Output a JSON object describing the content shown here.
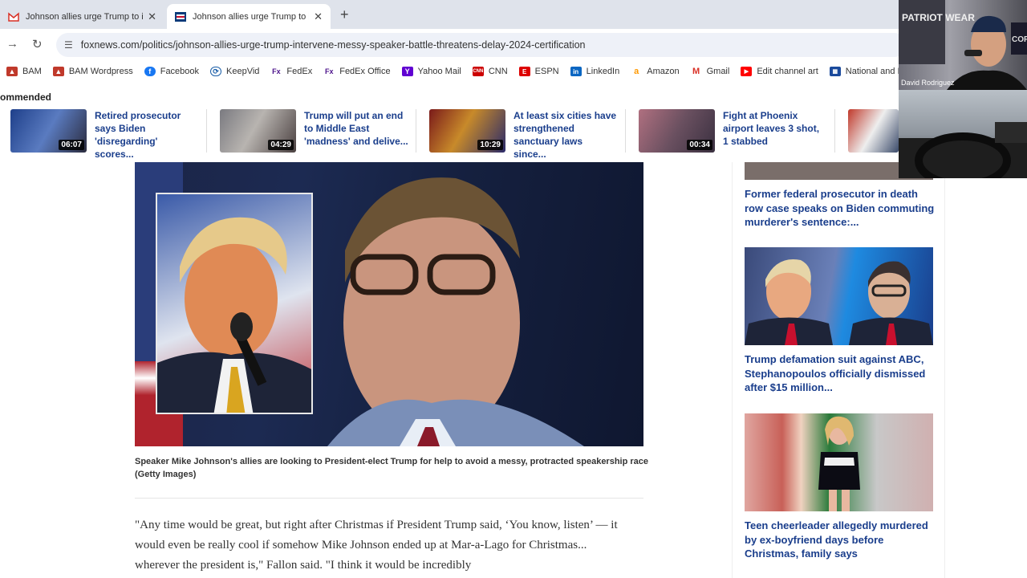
{
  "tabs": [
    {
      "title": "Johnson allies urge Trump to in",
      "active": false,
      "icon": "gmail-icon"
    },
    {
      "title": "Johnson allies urge Trump to in",
      "active": true,
      "icon": "foxnews-icon"
    }
  ],
  "url": "foxnews.com/politics/johnson-allies-urge-trump-intervene-messy-speaker-battle-threatens-delay-2024-certification",
  "bookmarks": [
    "BAM",
    "BAM Wordpress",
    "Facebook",
    "KeepVid",
    "FedEx",
    "FedEx Office",
    "Yahoo Mail",
    "CNN",
    "ESPN",
    "LinkedIn",
    "Amazon",
    "Gmail",
    "Edit channel art",
    "National and Local..."
  ],
  "recommended": {
    "label": "ommended",
    "items": [
      {
        "title": "Retired prosecutor says Biden 'disregarding' scores...",
        "duration": "06:07"
      },
      {
        "title": "Trump will put an end to Middle East 'madness' and delive...",
        "duration": "04:29"
      },
      {
        "title": "At least six cities have strengthened sanctuary laws since...",
        "duration": "10:29"
      },
      {
        "title": "Fight at Phoenix airport leaves 3 shot, 1 stabbed",
        "duration": "00:34"
      }
    ]
  },
  "caption": "Speaker Mike Johnson's allies are looking to President-elect Trump for help to avoid a messy, protracted speakership race (Getty Images)",
  "article_text": "\"Any time would be great, but right after Christmas if President Trump said, ‘You know, listen’ — it would even be really cool if somehow Mike Johnson ended up at Mar-a-Lago for Christmas... wherever the president is,\" Fallon said. \"I think it would be incredibly",
  "sidebar": [
    {
      "title": "Former federal prosecutor in death row case speaks on Biden commuting murderer's sentence:..."
    },
    {
      "title": "Trump defamation suit against ABC, Stephanopoulos officially dismissed after $15 million..."
    },
    {
      "title": "Teen cheerleader allegedly murdered by ex-boyfriend days before Christmas, family says"
    }
  ],
  "webcam": {
    "name": "David Rodriguez",
    "sign": "PATRIOT WEAR",
    "side": "CORI"
  }
}
